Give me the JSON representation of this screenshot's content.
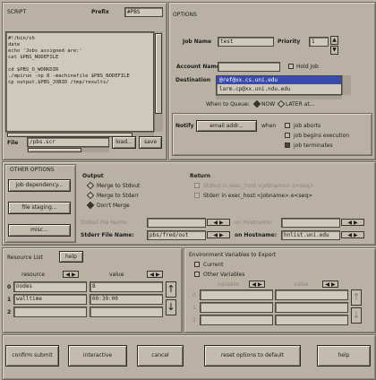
{
  "script_panel": {
    "title": "SCRIPT",
    "prefix_label": "Prefix",
    "prefix_value": "#PBS",
    "lines": [
      "#!/bin/sh",
      "date",
      "echo 'Jobs assigned are:'",
      "cat $PBS_NODEFILE",
      "",
      "cd $PBS_O_WORKDIR",
      "./mpirun -np 8 -machinefile $PBS_NODEFILE",
      "cp output.$PBS_JOBID /tmp/results/"
    ],
    "file_label": "File",
    "file_value": "/pbs.scr",
    "load_label": "load...",
    "save_label": "save"
  },
  "options_panel": {
    "title": "OPTIONS",
    "job_name_label": "Job Name",
    "job_name_value": "test",
    "priority_label": "Priority",
    "priority_value": "1",
    "account_label": "Account Name",
    "account_value": "",
    "hold_label": "Hold Job",
    "destination_label": "Destination",
    "destinations": [
      "@ref@xx.cs.uni.edu",
      "larm.cp@xx.uni.ndu.edu"
    ],
    "when_label": "When to Queue:",
    "when_now": "NOW",
    "when_later": "LATER at...",
    "notify_label": "Notify",
    "email_button": "email addr...",
    "when_notify": "when",
    "notify_options": [
      "job aborts",
      "job begins execution",
      "job terminates"
    ]
  },
  "other_options": {
    "title": "OTHER OPTIONS",
    "buttons": [
      "job dependency...",
      "file staging...",
      "misc..."
    ],
    "output_title": "Output",
    "output_options": [
      "Merge to Stdout",
      "Merge to Stderr",
      "Don't Merge"
    ],
    "return_title": "Return",
    "return_options": [
      "Stdout in exec_host:<jobname>.o<seq>",
      "Stderr in exec_host:<jobname>.e<seq>"
    ],
    "stdout_label": "Stdout File Name:",
    "stdout_host_label": "on Hostname:",
    "stderr_label": "Stderr File Name:",
    "stderr_value": "pbs/fred/out",
    "stderr_host_label": "on Hostname:",
    "stderr_host_value": "hnlist.uni.edu"
  },
  "resource_list": {
    "title": "Resource List",
    "help_label": "help",
    "col_resource": "resource",
    "col_value": "value",
    "rows": [
      {
        "idx": "0",
        "resource": "nodes",
        "value": "8"
      },
      {
        "idx": "1",
        "resource": "walltime",
        "value": "00:30:00"
      },
      {
        "idx": "2",
        "resource": "",
        "value": ""
      }
    ]
  },
  "env_vars": {
    "title": "Environment Variables to Export",
    "current_label": "Current",
    "other_label": "Other Variables",
    "col_variable": "variable",
    "col_value": "value",
    "rows": [
      "0",
      "1",
      "2"
    ]
  },
  "footer": {
    "confirm": "confirm submit",
    "interactive": "interactive",
    "cancel": "cancel",
    "reset": "reset options to default",
    "help": "help"
  }
}
